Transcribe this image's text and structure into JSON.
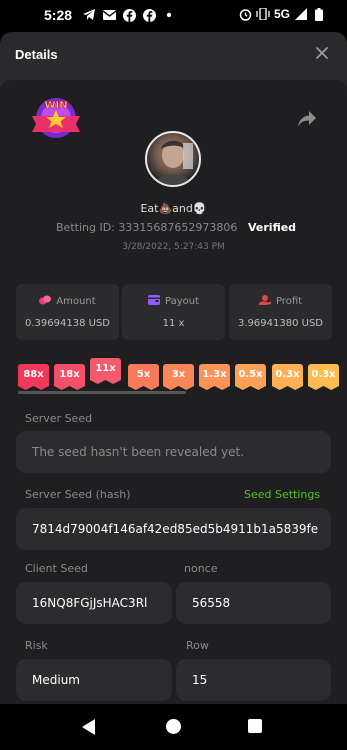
{
  "status_bar": {
    "time": "5:28",
    "left_icons": [
      "telegram-icon",
      "mail-icon",
      "facebook-icon",
      "facebook-icon",
      "dot-icon"
    ],
    "right_icons": [
      "alarm-icon",
      "vibrate-icon",
      "5g-signal-icon",
      "battery-icon"
    ],
    "network": "5G"
  },
  "header": {
    "title": "Details",
    "close_icon": "close-icon"
  },
  "profile": {
    "badge_icon": "win-badge-icon",
    "share_icon": "share-icon",
    "username": "Eat💩and💀",
    "betting_id_label": "Betting ID: 33315687652973806",
    "verified": "Verified",
    "datetime": "3/28/2022, 5:27:43 PM"
  },
  "stats": {
    "amount": {
      "label": "Amount",
      "value": "0.39694138 USD",
      "icon": "coins-icon",
      "color": "#e4407a"
    },
    "payout": {
      "label": "Payout",
      "value": "11 x",
      "icon": "wallet-icon",
      "color": "#8f5cf7"
    },
    "profit": {
      "label": "Profit",
      "value": "3.96941380 USD",
      "icon": "money-hand-icon",
      "color": "#e04848"
    }
  },
  "multipliers": [
    {
      "label": "88x",
      "color": "#f0385a"
    },
    {
      "label": "18x",
      "color": "#f2506a"
    },
    {
      "label": "11x",
      "color": "#f45a6e",
      "selected": true
    },
    {
      "label": "5x",
      "color": "#f77a5b"
    },
    {
      "label": "3x",
      "color": "#f9855a"
    },
    {
      "label": "1.3x",
      "color": "#fb9458"
    },
    {
      "label": "0.5x",
      "color": "#fca156"
    },
    {
      "label": "0.3x",
      "color": "#fdb055"
    },
    {
      "label": "0.3x",
      "color": "#fdbc52"
    }
  ],
  "form": {
    "server_seed_label": "Server Seed",
    "server_seed_value": "The seed hasn't been revealed yet.",
    "server_seed_hash_label": "Server Seed (hash)",
    "seed_settings_link": "Seed Settings",
    "server_seed_hash_value": "7814d79004f146af42ed85ed5b4911b1a5839fe",
    "client_seed_label": "Client Seed",
    "client_seed_value": "16NQ8FGjJsHAC3Rl",
    "nonce_label": "nonce",
    "nonce_value": "56558",
    "risk_label": "Risk",
    "risk_value": "Medium",
    "row_label": "Row",
    "row_value": "15"
  },
  "nav": {
    "back_icon": "back-triangle-icon",
    "home_icon": "home-circle-icon",
    "recent_icon": "recents-square-icon"
  }
}
